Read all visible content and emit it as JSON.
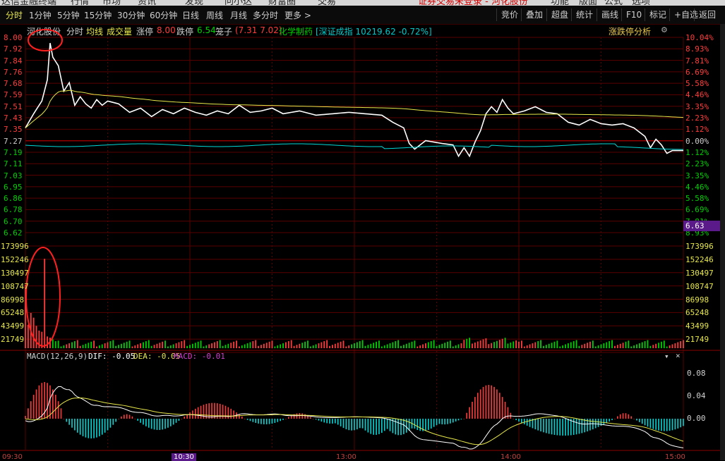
{
  "topbar": {
    "app_title": "达信金融终端",
    "menus": [
      "行情",
      "市场",
      "资讯",
      "发现",
      "问小达",
      "财富圈",
      "交易"
    ],
    "notice": "证券交易未登录 - 河化股份",
    "right_menus": [
      "功能",
      "版面",
      "公式",
      "选项"
    ]
  },
  "toolbar": {
    "tabs": [
      "分时",
      "1分钟",
      "5分钟",
      "15分钟",
      "30分钟",
      "60分钟",
      "日线",
      "周线",
      "月线",
      "多分时",
      "更多 >"
    ],
    "active_tab": 0,
    "buttons": [
      "竞价",
      "叠加",
      "超盘",
      "统计",
      "画线",
      "F10",
      "标记",
      "+自选",
      "返回"
    ]
  },
  "info": {
    "stock": "河化股份",
    "label_fenshi": "分时",
    "label_junxian": "均线",
    "label_volume": "成交量",
    "zt_label": "涨停",
    "zt_value": "8.00",
    "dt_label": "跌停",
    "dt_value": "6.54",
    "cage_label": "笼子",
    "cage_value": "(7.31 7.02)",
    "sector": "化学制药",
    "index": "[深证成指 10219.62 -0.72%]",
    "analysis_label": "涨跌停分析"
  },
  "price_axis": {
    "left": [
      "8.00",
      "7.92",
      "7.84",
      "7.76",
      "7.68",
      "7.59",
      "7.51",
      "7.43",
      "7.35",
      "7.27",
      "7.19",
      "7.11",
      "7.03",
      "6.95",
      "6.86",
      "6.78",
      "6.70",
      "6.62"
    ],
    "right": [
      "10.04%",
      "8.93%",
      "7.81%",
      "6.69%",
      "5.58%",
      "4.46%",
      "3.35%",
      "2.23%",
      "1.12%",
      "0.00%",
      "1.12%",
      "2.23%",
      "3.35%",
      "4.46%",
      "5.58%",
      "6.69%",
      "7.81%",
      "8.93%"
    ],
    "current_price": "6.63"
  },
  "volume_axis": {
    "left": [
      "173996",
      "152246",
      "130497",
      "108747",
      "86998",
      "65248",
      "43499",
      "21749"
    ],
    "right": [
      "173996",
      "152246",
      "130497",
      "108747",
      "86998",
      "65248",
      "43499",
      "21749"
    ]
  },
  "macd": {
    "title": "MACD(12,26,9)",
    "dif": "DIF: -0.05",
    "dea": "DEA: -0.05",
    "macd": "MACD: -0.01",
    "ticks": [
      "0.08",
      "0.04",
      "0.00"
    ]
  },
  "time_axis": [
    "09:30",
    "10:30",
    "13:00",
    "14:00",
    "15:00"
  ],
  "colors": {
    "up": "#ff3c3c",
    "down": "#00d000",
    "price_line": "#ffffff",
    "avg_line": "#e8e84a",
    "cyan": "#00d8d8",
    "grid": "#5a0000",
    "annotation": "#ff2020"
  }
}
